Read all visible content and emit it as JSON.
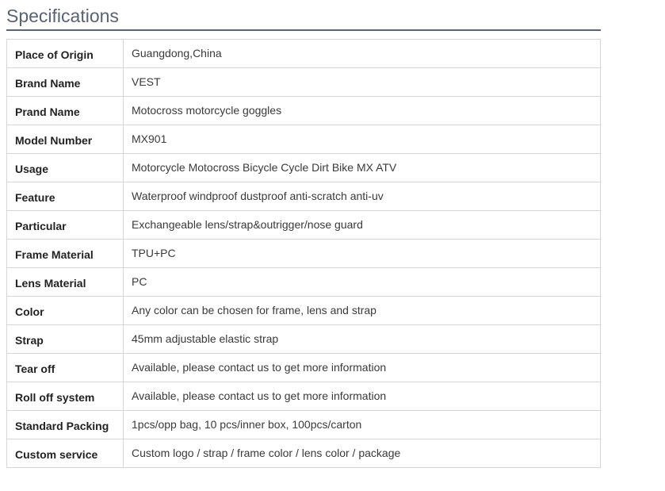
{
  "section": {
    "title": "Specifications"
  },
  "specs": [
    {
      "label": "Place of Origin",
      "value": "Guangdong,China"
    },
    {
      "label": "Brand Name",
      "value": "VEST"
    },
    {
      "label": "Prand Name",
      "value": "Motocross motorcycle goggles"
    },
    {
      "label": "Model Number",
      "value": "MX901"
    },
    {
      "label": "Usage",
      "value": "Motorcycle Motocross Bicycle Cycle Dirt Bike MX ATV"
    },
    {
      "label": "Feature",
      "value": "Waterproof windproof dustproof anti-scratch anti-uv"
    },
    {
      "label": "Particular",
      "value": "Exchangeable lens/strap&outrigger/nose guard"
    },
    {
      "label": "Frame Material",
      "value": "TPU+PC"
    },
    {
      "label": "Lens Material",
      "value": "PC"
    },
    {
      "label": "Color",
      "value": "Any color can be chosen for frame, lens and strap"
    },
    {
      "label": "Strap",
      "value": "45mm adjustable elastic strap"
    },
    {
      "label": "Tear off",
      "value": "Available, please contact us to get more information"
    },
    {
      "label": "Roll off system",
      "value": "Available, please contact us to get more information"
    },
    {
      "label": "Standard Packing",
      "value": "1pcs/opp bag, 10 pcs/inner box, 100pcs/carton"
    },
    {
      "label": "Custom service",
      "value": "Custom logo / strap / frame color / lens color / package"
    }
  ],
  "colors": {
    "title_text": "#5a6370",
    "title_rule": "#5a6472",
    "table_border": "#d6d6d6"
  }
}
